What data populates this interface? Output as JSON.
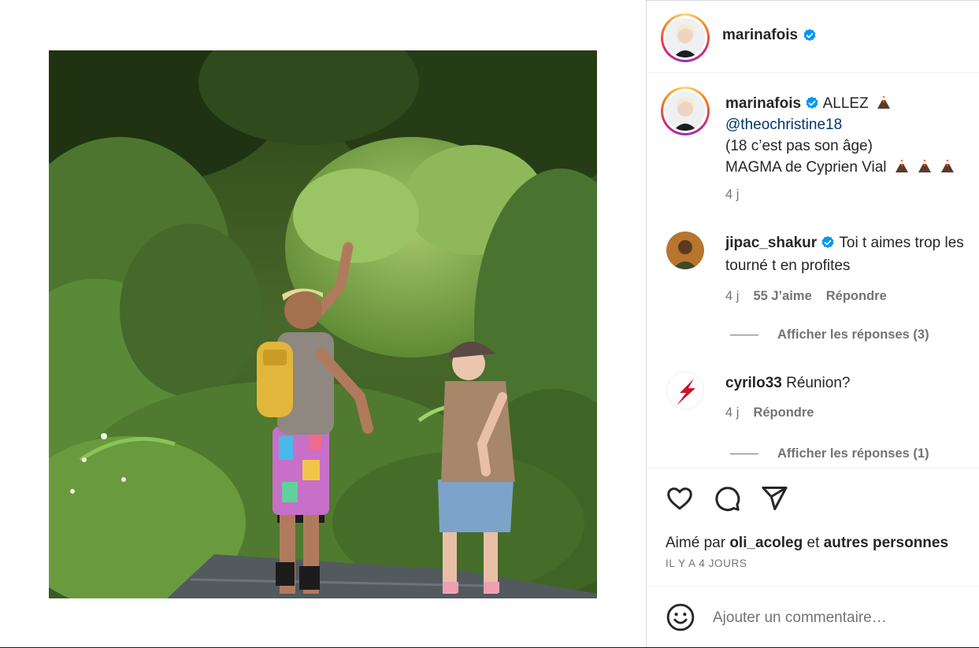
{
  "post": {
    "author": "marinafois",
    "verified": true
  },
  "caption": {
    "username": "marinafois",
    "line1_text": "ALLEZ",
    "mention": "@theochristine18",
    "line3": "(18 c’est pas son âge)",
    "line4": "MAGMA de Cyprien Vial",
    "time": "4 j",
    "emoji_icon": "volcano-emoji-icon"
  },
  "comments": [
    {
      "username": "jipac_shakur",
      "verified": true,
      "text_line1": "Toi t aimes trop les",
      "text_line2": "tourné t en profites",
      "time": "4 j",
      "likes": "55 J’aime",
      "reply": "Répondre",
      "view_replies": "Afficher les réponses (3)"
    },
    {
      "username": "cyrilo33",
      "verified": false,
      "text_line1": "Réunion?",
      "time": "4 j",
      "reply": "Répondre",
      "view_replies": "Afficher les réponses (1)"
    }
  ],
  "actions": {
    "like_icon": "heart-icon",
    "comment_icon": "comment-icon",
    "share_icon": "send-icon"
  },
  "likes": {
    "prefix": "Aimé par",
    "user": "oli_acoleg",
    "joiner": "et",
    "others": "autres personnes"
  },
  "timeago": "IL Y A 4 JOURS",
  "add_comment": {
    "placeholder": "Ajouter un commentaire…",
    "emoji_icon": "smiley-icon"
  },
  "colors": {
    "verified_blue": "#0095f6",
    "mention_blue": "#00376b",
    "secondary_text": "#737373"
  }
}
